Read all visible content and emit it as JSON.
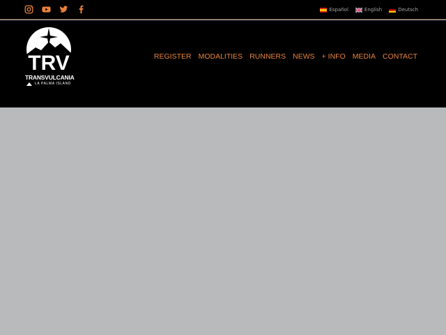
{
  "social": [
    {
      "name": "instagram-icon"
    },
    {
      "name": "youtube-icon"
    },
    {
      "name": "twitter-icon"
    },
    {
      "name": "facebook-icon"
    }
  ],
  "colors": {
    "accent": "#e8823a",
    "background": "#000000",
    "content": "#b9babc"
  },
  "languages": [
    {
      "label": "Español"
    },
    {
      "label": "English"
    },
    {
      "label": "Deutsch"
    }
  ],
  "logo": {
    "brand": "TRANSVULCANIA",
    "subtitle": "LA PALMA ISLAND",
    "monogram": "TRV"
  },
  "nav": [
    {
      "label": "REGISTER"
    },
    {
      "label": "MODALITIES"
    },
    {
      "label": "RUNNERS"
    },
    {
      "label": "NEWS"
    },
    {
      "label": "+ INFO"
    },
    {
      "label": "MEDIA"
    },
    {
      "label": "CONTACT"
    }
  ]
}
